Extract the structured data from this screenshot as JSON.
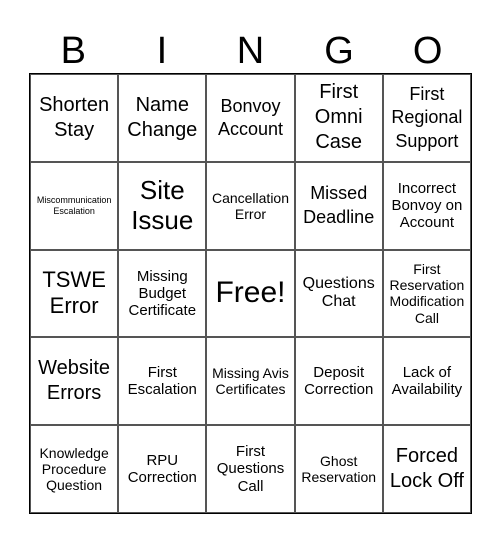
{
  "header": [
    "B",
    "I",
    "N",
    "G",
    "O"
  ],
  "cells": [
    [
      "Shorten Stay",
      "Name Change",
      "Bonvoy Account",
      "First Omni Case",
      "First Regional Support"
    ],
    [
      "Miscommunication Escalation",
      "Site Issue",
      "Cancellation Error",
      "Missed Deadline",
      "Incorrect Bonvoy on Account"
    ],
    [
      "TSWE Error",
      "Missing Budget Certificate",
      "Free!",
      "Questions Chat",
      "First Reservation Modification Call"
    ],
    [
      "Website Errors",
      "First Escalation",
      "Missing Avis Certificates",
      "Deposit Correction",
      "Lack of Availability"
    ],
    [
      "Knowledge Procedure Question",
      "RPU Correction",
      "First Questions Call",
      "Ghost Reservation",
      "Forced Lock Off"
    ]
  ]
}
